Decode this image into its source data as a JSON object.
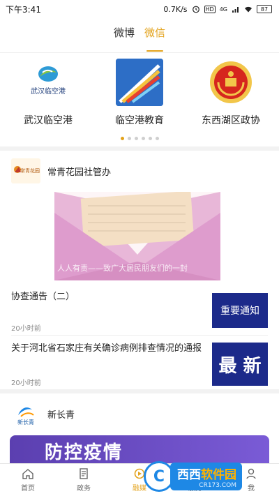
{
  "status_bar": {
    "time": "下午3:41",
    "speed": "0.7K/s",
    "hd": "HD",
    "network": "4G",
    "battery": "87"
  },
  "top_tabs": [
    {
      "label": "微博",
      "active": false
    },
    {
      "label": "微信",
      "active": true
    }
  ],
  "accounts": [
    {
      "name": "武汉临空港",
      "logo_text": "武汉临空港"
    },
    {
      "name": "临空港教育"
    },
    {
      "name": "东西湖区政协"
    }
  ],
  "carousel_dots": {
    "count": 6,
    "active_index": 0
  },
  "feed": {
    "card1": {
      "org_name": "常青花园社管办",
      "avatar_text": "常青花园",
      "banner_caption": "人人有责——致广大居民朋友们的一封",
      "items": [
        {
          "title": "协查通告（二）",
          "time": "20小时前",
          "thumb_text": "重要通知"
        },
        {
          "title": "关于河北省石家庄有关确诊病例排查情况的通报",
          "time": "20小时前",
          "thumb_text": "最 新"
        }
      ]
    },
    "card2": {
      "org_name": "新长青",
      "avatar_text": "新长青",
      "banner_text": "防控疫情"
    }
  },
  "bottom_nav": [
    {
      "label": "首页",
      "icon": "home-icon",
      "active": false
    },
    {
      "label": "政务",
      "icon": "document-icon",
      "active": false
    },
    {
      "label": "融媒",
      "icon": "media-icon",
      "active": true
    },
    {
      "label": "服务",
      "icon": "service-icon",
      "active": false
    },
    {
      "label": "我",
      "icon": "user-icon",
      "active": false
    }
  ],
  "watermark": {
    "logo": "C",
    "title_a": "西西",
    "title_b": "软件园",
    "sub": "CR173.COM"
  },
  "colors": {
    "accent": "#e3a21a",
    "notice_bg": "#1c2a8a",
    "banner_purple": "#6a4cc4"
  }
}
